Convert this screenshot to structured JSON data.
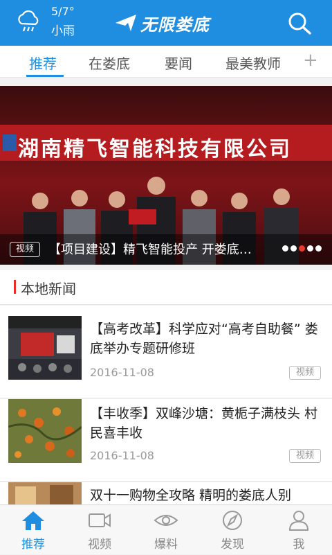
{
  "header": {
    "weather_temp": "5/7°",
    "weather_desc": "小雨",
    "logo_text": "无限娄底",
    "weather_icon": "rain-cloud-icon",
    "search_icon": "search-icon"
  },
  "tabs": [
    {
      "label": "推荐",
      "active": true
    },
    {
      "label": "在娄底",
      "active": false
    },
    {
      "label": "要闻",
      "active": false
    },
    {
      "label": "最美教师",
      "active": false
    }
  ],
  "tab_more": "+",
  "banner": {
    "sign_text": "湖南精飞智能科技有限公司",
    "badge": "视频",
    "title": "【项目建设】精飞智能投产 开娄底…",
    "slides": 5,
    "active_slide": 3
  },
  "section": {
    "title": "本地新闻"
  },
  "news": [
    {
      "title": "【高考改革】科学应对“高考自助餐” 娄底举办专题研修班",
      "date": "2016-11-08",
      "tag": "视频"
    },
    {
      "title": "【丰收季】双峰沙塘：黄栀子满枝头 村民喜丰收",
      "date": "2016-11-08",
      "tag": "视频"
    },
    {
      "title": "双十一购物全攻略 精明的娄底人别",
      "date": "",
      "tag": ""
    }
  ],
  "bottom_nav": [
    {
      "label": "推荐",
      "icon": "home-icon",
      "active": true
    },
    {
      "label": "视频",
      "icon": "video-camera-icon",
      "active": false
    },
    {
      "label": "爆料",
      "icon": "eye-icon",
      "active": false
    },
    {
      "label": "发现",
      "icon": "compass-icon",
      "active": false
    },
    {
      "label": "我",
      "icon": "user-icon",
      "active": false
    }
  ],
  "colors": {
    "brand": "#1f8ee0",
    "accent": "#e62e24",
    "banner_sign": "#b51c20"
  }
}
